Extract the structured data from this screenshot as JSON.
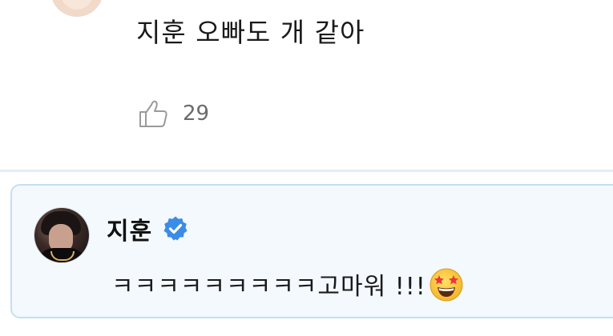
{
  "comment": {
    "text": "지훈 오빠도 개 같아",
    "like_count": "29",
    "icons": {
      "avatar": "user-avatar",
      "like": "thumbs-up-icon"
    }
  },
  "reply": {
    "author_name": "지훈",
    "text": "ㅋㅋㅋㅋㅋㅋㅋㅋㅋ고마워 !!!",
    "icons": {
      "verified": "verified-badge-icon",
      "emoji": "star-struck-emoji-icon",
      "avatar": "author-avatar"
    }
  },
  "colors": {
    "reply_background": "#f4f9fd",
    "reply_border": "#c4dff1",
    "verified_badge": "#3b8ce6",
    "divider": "#e3eef6",
    "like_text": "#6b6b6b"
  }
}
